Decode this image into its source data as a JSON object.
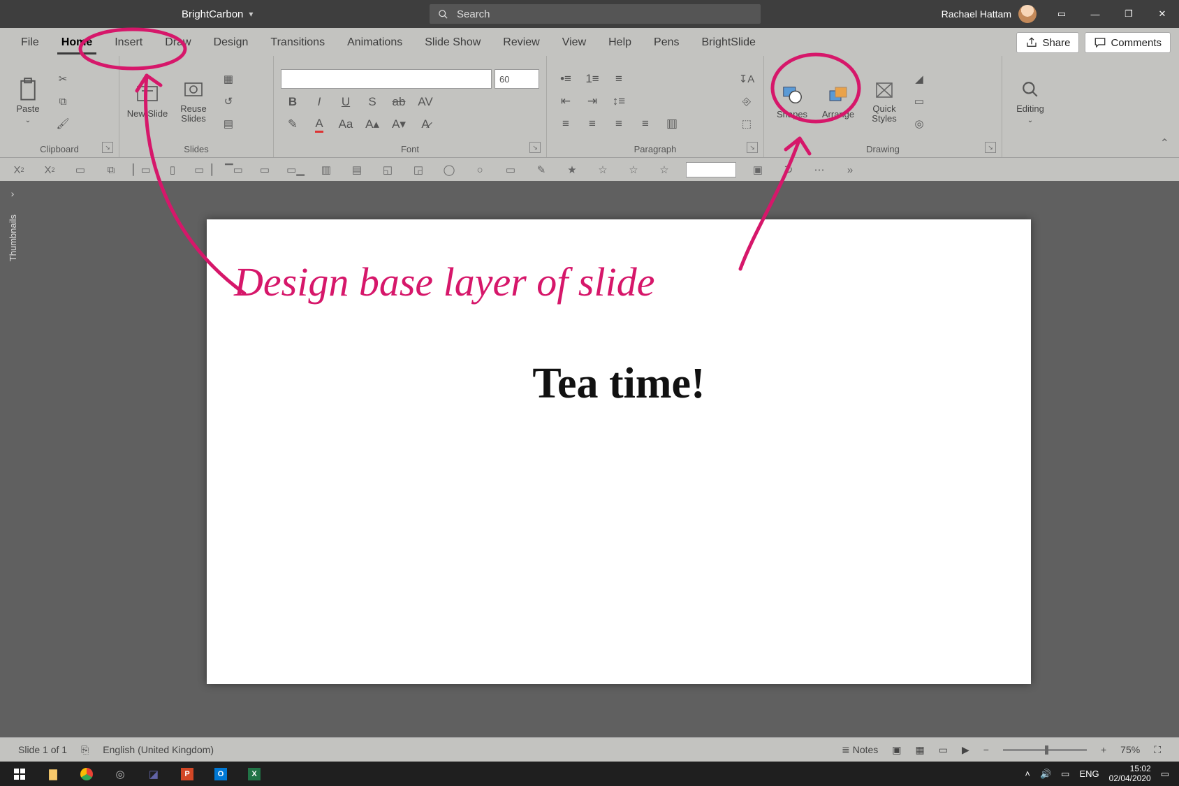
{
  "titlebar": {
    "doc_title": "BrightCarbon",
    "search_placeholder": "Search",
    "user_name": "Rachael Hattam"
  },
  "tabs": {
    "items": [
      "File",
      "Home",
      "Insert",
      "Draw",
      "Design",
      "Transitions",
      "Animations",
      "Slide Show",
      "Review",
      "View",
      "Help",
      "Pens",
      "BrightSlide"
    ],
    "active_index": 1,
    "share_label": "Share",
    "comments_label": "Comments"
  },
  "ribbon": {
    "clipboard": {
      "label": "Clipboard",
      "paste": "Paste"
    },
    "slides": {
      "label": "Slides",
      "new_slide": "New Slide",
      "reuse": "Reuse Slides"
    },
    "font": {
      "label": "Font",
      "size": "60"
    },
    "paragraph": {
      "label": "Paragraph"
    },
    "drawing": {
      "label": "Drawing",
      "shapes": "Shapes",
      "arrange": "Arrange",
      "quick_styles": "Quick Styles"
    },
    "editing": {
      "label": "Editing",
      "editing": "Editing"
    }
  },
  "slide": {
    "title_text": "Tea time!"
  },
  "status": {
    "slide_counter": "Slide 1 of 1",
    "language": "English (United Kingdom)",
    "notes_label": "Notes",
    "zoom": "75%"
  },
  "taskbar": {
    "lang": "ENG",
    "time": "15:02",
    "date": "02/04/2020"
  },
  "annotation": {
    "handwriting": "Design base layer of slide"
  }
}
